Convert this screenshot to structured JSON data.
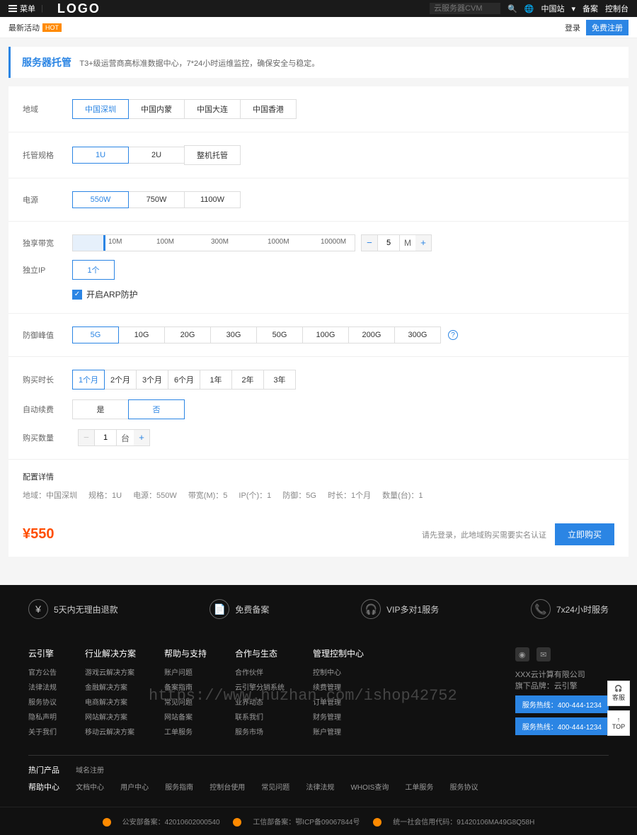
{
  "topbar": {
    "menu": "菜单",
    "logo": "LOGO",
    "search_placeholder": "云服务器CVM",
    "region": "中国站",
    "beian": "备案",
    "console": "控制台"
  },
  "subbar": {
    "activity": "最新活动",
    "hot": "HOT",
    "login": "登录",
    "register": "免费注册"
  },
  "header": {
    "title": "服务器托管",
    "desc": "T3+级运营商高标准数据中心，7*24小时运维监控，确保安全与稳定。"
  },
  "config": {
    "region": {
      "label": "地域",
      "options": [
        "中国深圳",
        "中国内蒙",
        "中国大连",
        "中国香港"
      ],
      "selected": "中国深圳"
    },
    "spec": {
      "label": "托管规格",
      "options": [
        "1U",
        "2U",
        "整机托管"
      ],
      "selected": "1U"
    },
    "power": {
      "label": "电源",
      "options": [
        "550W",
        "750W",
        "1100W"
      ],
      "selected": "550W"
    },
    "bandwidth": {
      "label": "独享带宽",
      "ticks": [
        "10M",
        "100M",
        "300M",
        "1000M",
        "10000M"
      ],
      "value": "5",
      "unit": "M"
    },
    "ip": {
      "label": "独立IP",
      "options": [
        "1个"
      ],
      "selected": "1个"
    },
    "arp": {
      "label": "开启ARP防护",
      "checked": true
    },
    "defense": {
      "label": "防御峰值",
      "options": [
        "5G",
        "10G",
        "20G",
        "30G",
        "50G",
        "100G",
        "200G",
        "300G"
      ],
      "selected": "5G"
    },
    "duration": {
      "label": "购买时长",
      "options": [
        "1个月",
        "2个月",
        "3个月",
        "6个月",
        "1年",
        "2年",
        "3年"
      ],
      "selected": "1个月"
    },
    "renew": {
      "label": "自动续费",
      "options": [
        "是",
        "否"
      ],
      "selected": "否"
    },
    "quantity": {
      "label": "购买数量",
      "value": "1",
      "unit": "台"
    }
  },
  "summary": {
    "label": "配置详情",
    "items": [
      "地域：中国深圳",
      "规格：1U",
      "电源：550W",
      "带宽(M)：5",
      "IP(个)：1",
      "防御：5G",
      "时长：1个月",
      "数量(台)：1"
    ]
  },
  "price": {
    "currency": "¥",
    "amount": "550",
    "note": "请先登录，此地域购买需要实名认证",
    "buy": "立即购买"
  },
  "features": [
    "5天内无理由退款",
    "免费备案",
    "VIP多对1服务",
    "7x24小时服务"
  ],
  "footer": {
    "cols": [
      {
        "title": "云引擎",
        "links": [
          "官方公告",
          "法律法规",
          "服务协议",
          "隐私声明",
          "关于我们"
        ]
      },
      {
        "title": "行业解决方案",
        "links": [
          "游戏云解决方案",
          "金融解决方案",
          "电商解决方案",
          "网站解决方案",
          "移动云解决方案"
        ]
      },
      {
        "title": "帮助与支持",
        "links": [
          "账户问题",
          "备案指南",
          "常见问题",
          "网站备案",
          "工单服务"
        ]
      },
      {
        "title": "合作与生态",
        "links": [
          "合作伙伴",
          "云引擎分销系统",
          "业界动态",
          "联系我们",
          "服务市场"
        ]
      },
      {
        "title": "管理控制中心",
        "links": [
          "控制中心",
          "续费管理",
          "订单管理",
          "财务管理",
          "账户管理"
        ]
      }
    ],
    "contact": {
      "company": "XXX云计算有限公司",
      "brand": "旗下品牌：云引擎",
      "hotline1": "服务热线：400-444-1234",
      "hotline2": "服务热线：400-444-1234"
    },
    "hot_products": {
      "title": "热门产品",
      "links": [
        "域名注册",
        "",
        "",
        "",
        "",
        "",
        "",
        "",
        ""
      ]
    },
    "help_center": {
      "title": "帮助中心",
      "links": [
        "文档中心",
        "用户中心",
        "服务指南",
        "控制台使用",
        "常见问题",
        "法律法规",
        "WHOIS查询",
        "工单服务",
        "服务协议"
      ]
    },
    "bottom": {
      "gongan": "公安部备案：42010602000540",
      "icp": "工信部备案：鄂ICP备09067844号",
      "credit": "统一社会信用代码：91420106MA49G8Q58H"
    }
  },
  "float": {
    "kefu": "客服",
    "top": "TOP"
  },
  "watermark": "https://www.huzhan.com/ishop42752"
}
